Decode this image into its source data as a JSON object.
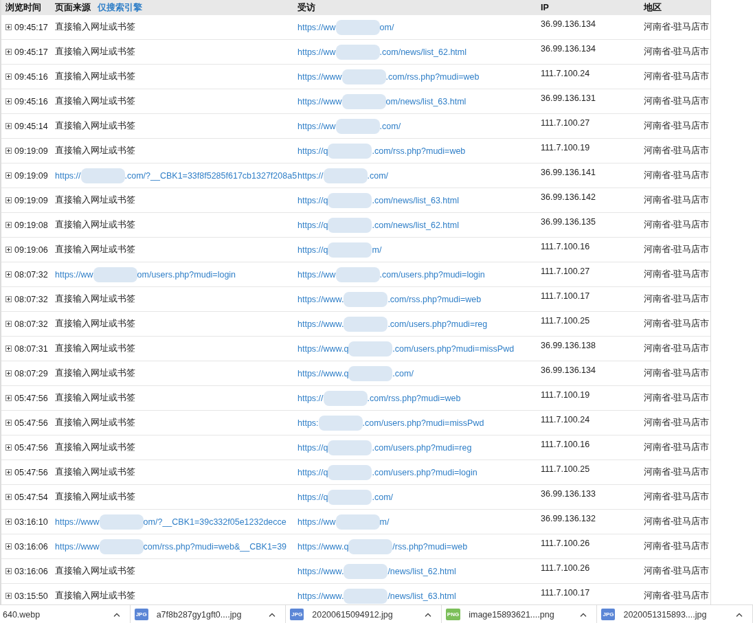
{
  "table": {
    "columns": [
      {
        "label": "浏览时间"
      },
      {
        "label": "页面来源",
        "filter_link": "仅搜索引擎"
      },
      {
        "label": "受访"
      },
      {
        "label": "IP"
      },
      {
        "label": "地区"
      }
    ],
    "rows": [
      {
        "time": "09:45:17",
        "source": {
          "kind": "text",
          "text": "直接输入网址或书签"
        },
        "visited": [
          "https://ww",
          "om/"
        ],
        "ip": "36.99.136.134",
        "region": "河南省-驻马店市"
      },
      {
        "time": "09:45:17",
        "source": {
          "kind": "text",
          "text": "直接输入网址或书签"
        },
        "visited": [
          "https://ww",
          ".com/news/list_62.html"
        ],
        "ip": "36.99.136.134",
        "region": "河南省-驻马店市"
      },
      {
        "time": "09:45:16",
        "source": {
          "kind": "text",
          "text": "直接输入网址或书签"
        },
        "visited": [
          "https://www",
          ".com/rss.php?mudi=web"
        ],
        "ip": "111.7.100.24",
        "region": "河南省-驻马店市"
      },
      {
        "time": "09:45:16",
        "source": {
          "kind": "text",
          "text": "直接输入网址或书签"
        },
        "visited": [
          "https://www",
          "om/news/list_63.html"
        ],
        "ip": "36.99.136.131",
        "region": "河南省-驻马店市"
      },
      {
        "time": "09:45:14",
        "source": {
          "kind": "text",
          "text": "直接输入网址或书签"
        },
        "visited": [
          "https://ww",
          ".com/"
        ],
        "ip": "111.7.100.27",
        "region": "河南省-驻马店市"
      },
      {
        "time": "09:19:09",
        "source": {
          "kind": "text",
          "text": "直接输入网址或书签"
        },
        "visited": [
          "https://q",
          ".com/rss.php?mudi=web"
        ],
        "ip": "111.7.100.19",
        "region": "河南省-驻马店市"
      },
      {
        "time": "09:19:09",
        "source": {
          "kind": "link",
          "parts": [
            "https://",
            ".com/?__CBK1=33f8f5285f617cb1327f208a5"
          ]
        },
        "visited": [
          "https://",
          ".com/"
        ],
        "ip": "36.99.136.141",
        "region": "河南省-驻马店市"
      },
      {
        "time": "09:19:09",
        "source": {
          "kind": "text",
          "text": "直接输入网址或书签"
        },
        "visited": [
          "https://q",
          ".com/news/list_63.html"
        ],
        "ip": "36.99.136.142",
        "region": "河南省-驻马店市"
      },
      {
        "time": "09:19:08",
        "source": {
          "kind": "text",
          "text": "直接输入网址或书签"
        },
        "visited": [
          "https://q",
          ".com/news/list_62.html"
        ],
        "ip": "36.99.136.135",
        "region": "河南省-驻马店市"
      },
      {
        "time": "09:19:06",
        "source": {
          "kind": "text",
          "text": "直接输入网址或书签"
        },
        "visited": [
          "https://q",
          "m/"
        ],
        "ip": "111.7.100.16",
        "region": "河南省-驻马店市"
      },
      {
        "time": "08:07:32",
        "source": {
          "kind": "link",
          "parts": [
            "https://ww",
            "om/users.php?mudi=login"
          ]
        },
        "visited": [
          "https://ww",
          ".com/users.php?mudi=login"
        ],
        "ip": "111.7.100.27",
        "region": "河南省-驻马店市"
      },
      {
        "time": "08:07:32",
        "source": {
          "kind": "text",
          "text": "直接输入网址或书签"
        },
        "visited": [
          "https://www.",
          ".com/rss.php?mudi=web"
        ],
        "ip": "111.7.100.17",
        "region": "河南省-驻马店市"
      },
      {
        "time": "08:07:32",
        "source": {
          "kind": "text",
          "text": "直接输入网址或书签"
        },
        "visited": [
          "https://www.",
          ".com/users.php?mudi=reg"
        ],
        "ip": "111.7.100.25",
        "region": "河南省-驻马店市"
      },
      {
        "time": "08:07:31",
        "source": {
          "kind": "text",
          "text": "直接输入网址或书签"
        },
        "visited": [
          "https://www.q",
          ".com/users.php?mudi=missPwd"
        ],
        "ip": "36.99.136.138",
        "region": "河南省-驻马店市"
      },
      {
        "time": "08:07:29",
        "source": {
          "kind": "text",
          "text": "直接输入网址或书签"
        },
        "visited": [
          "https://www.q",
          ".com/"
        ],
        "ip": "36.99.136.134",
        "region": "河南省-驻马店市"
      },
      {
        "time": "05:47:56",
        "source": {
          "kind": "text",
          "text": "直接输入网址或书签"
        },
        "visited": [
          "https://",
          ".com/rss.php?mudi=web"
        ],
        "ip": "111.7.100.19",
        "region": "河南省-驻马店市"
      },
      {
        "time": "05:47:56",
        "source": {
          "kind": "text",
          "text": "直接输入网址或书签"
        },
        "visited": [
          "https:",
          ".com/users.php?mudi=missPwd"
        ],
        "ip": "111.7.100.24",
        "region": "河南省-驻马店市"
      },
      {
        "time": "05:47:56",
        "source": {
          "kind": "text",
          "text": "直接输入网址或书签"
        },
        "visited": [
          "https://q",
          ".com/users.php?mudi=reg"
        ],
        "ip": "111.7.100.16",
        "region": "河南省-驻马店市"
      },
      {
        "time": "05:47:56",
        "source": {
          "kind": "text",
          "text": "直接输入网址或书签"
        },
        "visited": [
          "https://q",
          ".com/users.php?mudi=login"
        ],
        "ip": "111.7.100.25",
        "region": "河南省-驻马店市"
      },
      {
        "time": "05:47:54",
        "source": {
          "kind": "text",
          "text": "直接输入网址或书签"
        },
        "visited": [
          "https://q",
          ".com/"
        ],
        "ip": "36.99.136.133",
        "region": "河南省-驻马店市"
      },
      {
        "time": "03:16:10",
        "source": {
          "kind": "link",
          "parts": [
            "https://www",
            "om/?__CBK1=39c332f05e1232decce"
          ]
        },
        "visited": [
          "https://ww",
          "m/"
        ],
        "ip": "36.99.136.132",
        "region": "河南省-驻马店市"
      },
      {
        "time": "03:16:06",
        "source": {
          "kind": "link",
          "parts": [
            "https://www",
            "com/rss.php?mudi=web&__CBK1=39"
          ]
        },
        "visited": [
          "https://www.q",
          "/rss.php?mudi=web"
        ],
        "ip": "111.7.100.26",
        "region": "河南省-驻马店市"
      },
      {
        "time": "03:16:06",
        "source": {
          "kind": "text",
          "text": "直接输入网址或书签"
        },
        "visited": [
          "https://www.",
          "/news/list_62.html"
        ],
        "ip": "111.7.100.26",
        "region": "河南省-驻马店市"
      },
      {
        "time": "03:15:50",
        "source": {
          "kind": "text",
          "text": "直接输入网址或书签"
        },
        "visited": [
          "https://www.",
          "/news/list_63.html"
        ],
        "ip": "111.7.100.17",
        "region": "河南省-驻马店市"
      }
    ]
  },
  "downloads": [
    {
      "name": "640.webp"
    },
    {
      "name": "a7f8b287gy1gft0....jpg",
      "badge": "JPG",
      "kind": "jpg"
    },
    {
      "name": "20200615094912.jpg",
      "badge": "JPG",
      "kind": "jpg"
    },
    {
      "name": "image15893621....png",
      "badge": "PNG",
      "kind": "png"
    },
    {
      "name": "2020051315893....jpg",
      "badge": "JPG",
      "kind": "jpg"
    }
  ]
}
